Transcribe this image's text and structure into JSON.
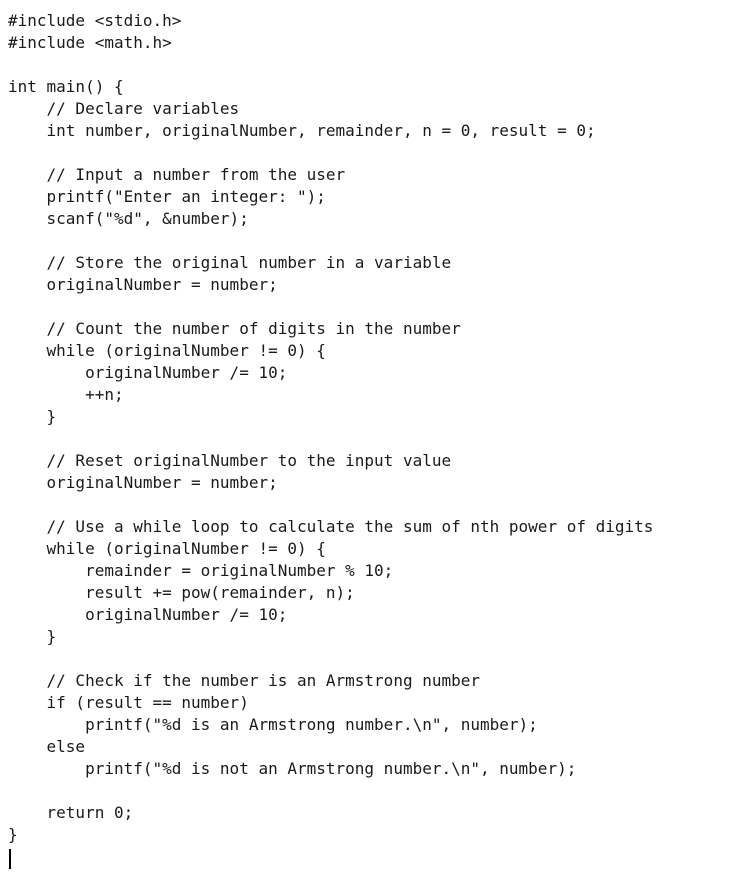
{
  "editor": {
    "lines": [
      "#include <stdio.h>",
      "#include <math.h>",
      "",
      "int main() {",
      "    // Declare variables",
      "    int number, originalNumber, remainder, n = 0, result = 0;",
      "",
      "    // Input a number from the user",
      "    printf(\"Enter an integer: \");",
      "    scanf(\"%d\", &number);",
      "",
      "    // Store the original number in a variable",
      "    originalNumber = number;",
      "",
      "    // Count the number of digits in the number",
      "    while (originalNumber != 0) {",
      "        originalNumber /= 10;",
      "        ++n;",
      "    }",
      "",
      "    // Reset originalNumber to the input value",
      "    originalNumber = number;",
      "",
      "    // Use a while loop to calculate the sum of nth power of digits",
      "    while (originalNumber != 0) {",
      "        remainder = originalNumber % 10;",
      "        result += pow(remainder, n);",
      "        originalNumber /= 10;",
      "    }",
      "",
      "    // Check if the number is an Armstrong number",
      "    if (result == number)",
      "        printf(\"%d is an Armstrong number.\\n\", number);",
      "    else",
      "        printf(\"%d is not an Armstrong number.\\n\", number);",
      "",
      "    return 0;",
      "}"
    ]
  }
}
